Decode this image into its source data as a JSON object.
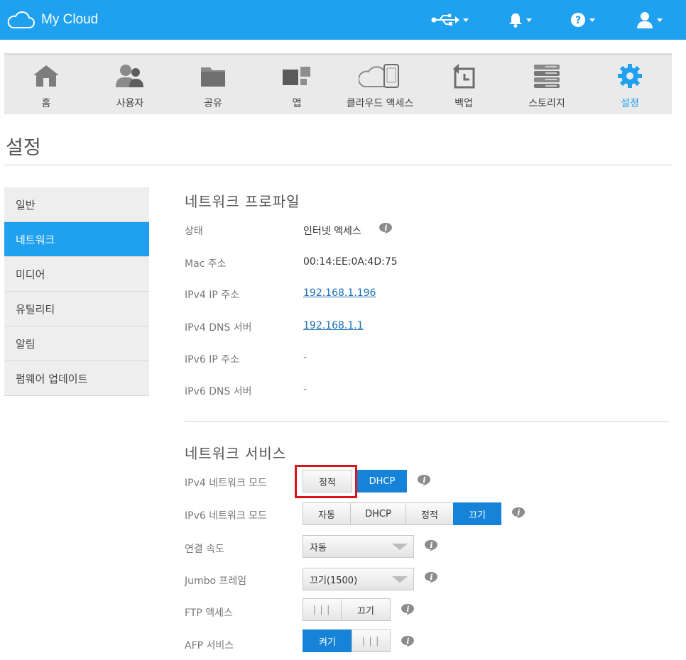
{
  "topbar": {
    "brand": "My Cloud",
    "icons": [
      "usb-icon",
      "bell-icon",
      "help-icon",
      "user-icon"
    ],
    "accent": "#1fa1ef"
  },
  "nav": {
    "items": [
      {
        "label": "홈",
        "icon": "home-icon"
      },
      {
        "label": "사용자",
        "icon": "users-icon"
      },
      {
        "label": "공유",
        "icon": "shares-icon"
      },
      {
        "label": "앱",
        "icon": "apps-icon"
      },
      {
        "label": "클라우드 액세스",
        "icon": "cloud-access-icon"
      },
      {
        "label": "백업",
        "icon": "backup-icon"
      },
      {
        "label": "스토리지",
        "icon": "storage-icon"
      },
      {
        "label": "설정",
        "icon": "gear-icon",
        "active": true
      }
    ]
  },
  "page": {
    "title": "설정"
  },
  "sidemenu": {
    "items": [
      {
        "label": "일반"
      },
      {
        "label": "네트워크",
        "active": true
      },
      {
        "label": "미디어"
      },
      {
        "label": "유틸리티"
      },
      {
        "label": "알림"
      },
      {
        "label": "펌웨어 업데이트"
      }
    ]
  },
  "profile": {
    "title": "네트워크 프로파일",
    "status_label": "상태",
    "status_value": "인터넷 액세스",
    "mac_label": "Mac 주소",
    "mac_value": "00:14:EE:0A:4D:75",
    "ipv4_label": "IPv4 IP 주소",
    "ipv4_value": "192.168.1.196",
    "ipv4dns_label": "IPv4 DNS 서버",
    "ipv4dns_value": "192.168.1.1",
    "ipv6_label": "IPv6 IP 주소",
    "ipv6_value": "-",
    "ipv6dns_label": "IPv6 DNS 서버",
    "ipv6dns_value": "-"
  },
  "services": {
    "title": "네트워크 서비스",
    "ipv4mode_label": "IPv4 네트워크 모드",
    "ipv4mode_options": [
      "정적",
      "DHCP"
    ],
    "ipv4mode_selected": "DHCP",
    "ipv6mode_label": "IPv6 네트워크 모드",
    "ipv6mode_options": [
      "자동",
      "DHCP",
      "정적",
      "끄기"
    ],
    "ipv6mode_selected": "끄기",
    "speed_label": "연결 속도",
    "speed_value": "자동",
    "jumbo_label": "Jumbo 프레임",
    "jumbo_value": "끄기(1500)",
    "ftp_label": "FTP 액세스",
    "ftp_state": "끄기",
    "afp_label": "AFP 서비스",
    "afp_state": "켜기",
    "grip": "|||"
  }
}
